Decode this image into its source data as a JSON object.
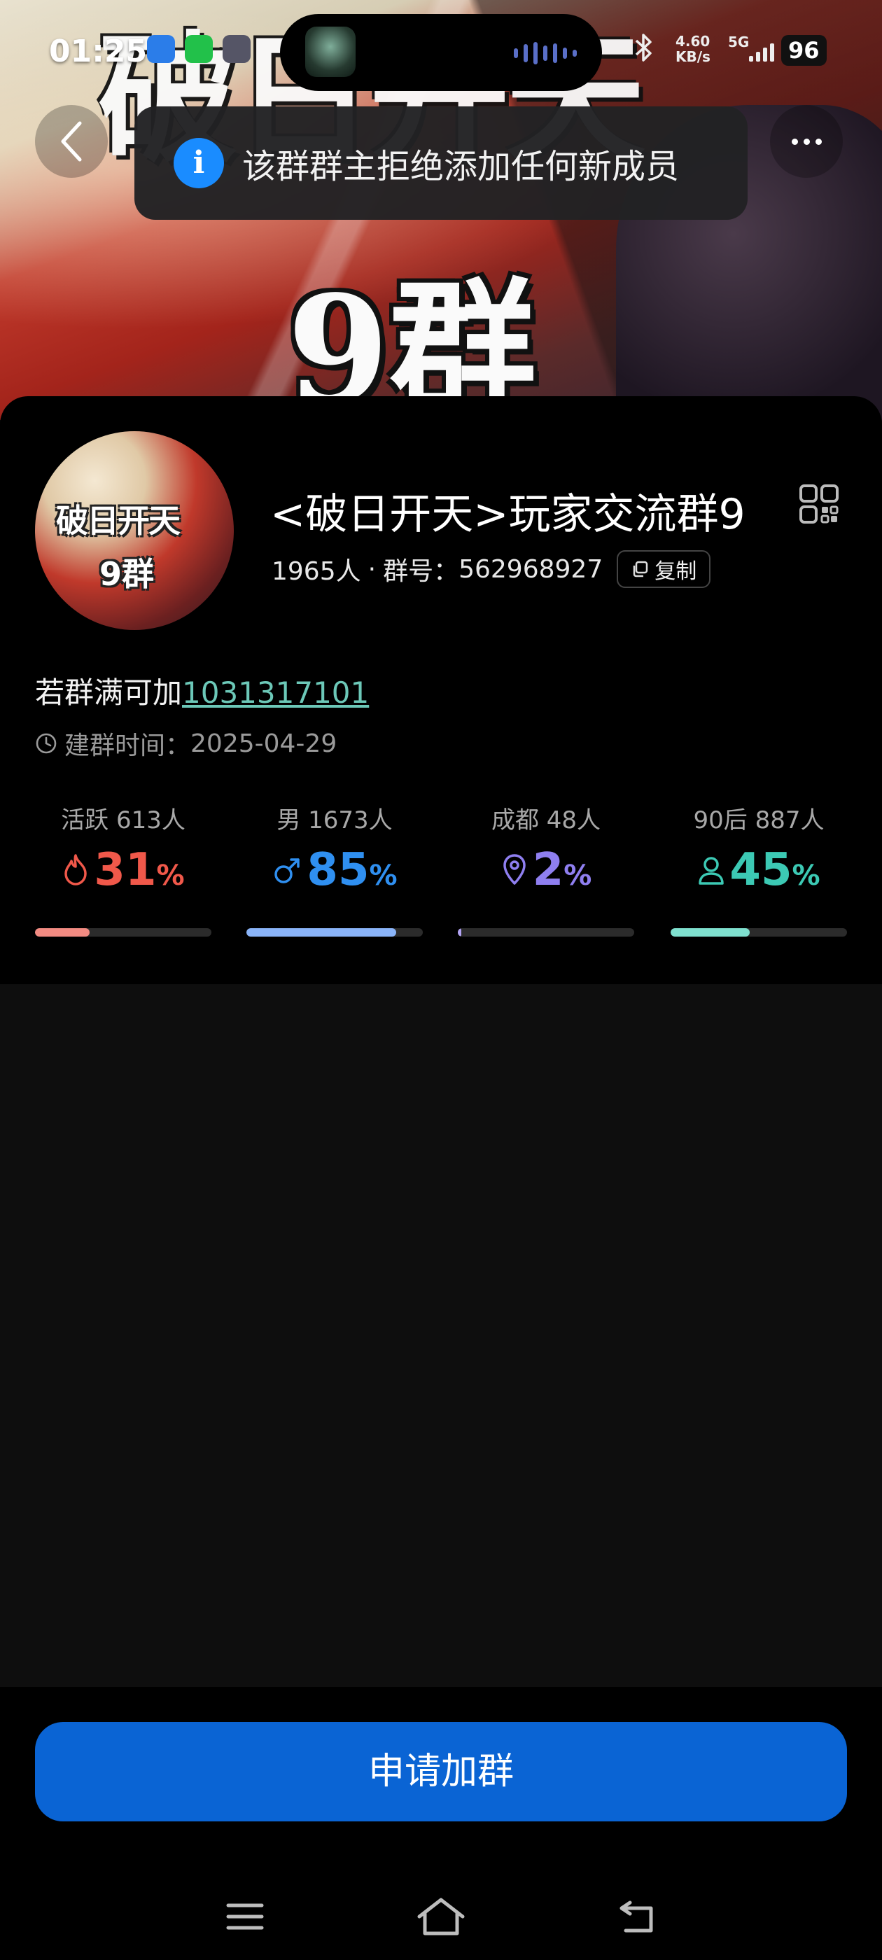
{
  "status_bar": {
    "time": "01:25",
    "network_speed_value": "4.60",
    "network_speed_unit": "KB/s",
    "network_type": "5G",
    "battery": "96"
  },
  "hero": {
    "banner_text_top": "破日开天",
    "banner_text_group": "9群"
  },
  "toast": {
    "message": "该群群主拒绝添加任何新成员",
    "icon": "info-icon"
  },
  "group": {
    "avatar_line1": "破日开天",
    "avatar_line2": "9群",
    "name": "<破日开天>玩家交流群9",
    "member_count": "1965人",
    "separator": "·",
    "id_label": "群号：",
    "id": "562968927",
    "copy_label": "复制",
    "note_prefix": "若群满可加",
    "note_link": "1031317101",
    "created_label": "建群时间：",
    "created_date": "2025-04-29"
  },
  "stats": [
    {
      "label": "活跃 613人",
      "value": "31",
      "unit": "%",
      "icon": "flame-icon",
      "color": "#f0584a",
      "fill": 0.31
    },
    {
      "label": "男 1673人",
      "value": "85",
      "unit": "%",
      "icon": "male-icon",
      "color": "#2f8ff0",
      "fill": 0.85
    },
    {
      "label": "成都 48人",
      "value": "2",
      "unit": "%",
      "icon": "location-pin-icon",
      "color": "#8f7ff0",
      "fill": 0.02
    },
    {
      "label": "90后 887人",
      "value": "45",
      "unit": "%",
      "icon": "person-icon",
      "color": "#3cc9b4",
      "fill": 0.45
    }
  ],
  "stat_bar_colors": [
    "#f28b82",
    "#8ab4f8",
    "#b3a4f5",
    "#7fe0cf"
  ],
  "actions": {
    "apply_label": "申请加群"
  },
  "colors": {
    "accent_blue": "#0a64d4",
    "link_teal": "#6cc8b8",
    "toast_info": "#1a8cff"
  }
}
